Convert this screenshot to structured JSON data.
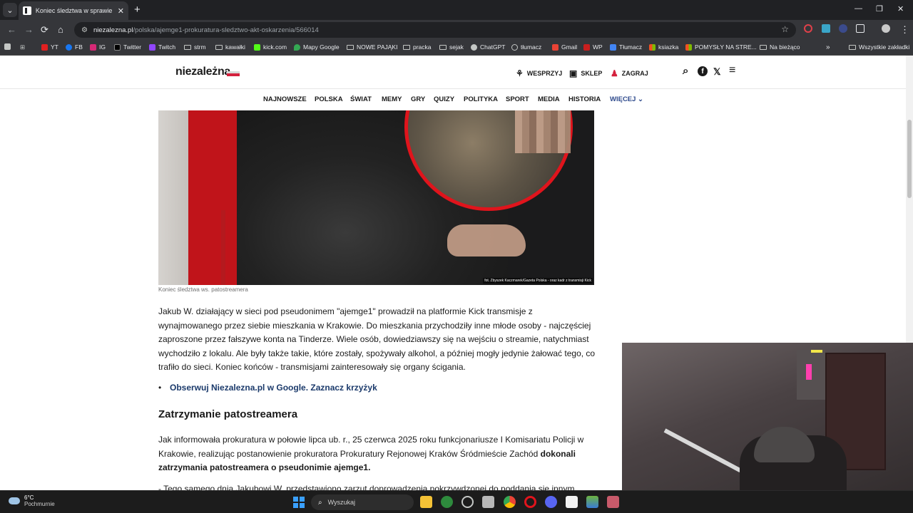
{
  "browser": {
    "tab_title": "Koniec śledztwa w sprawie pato",
    "url_host": "niezalezna.pl",
    "url_path": "/polska/ajemge1-prokuratura-sledztwo-akt-oskarzenia/566014",
    "bookmarks": [
      "YT",
      "FB",
      "IG",
      "Twitter",
      "Twitch",
      "strm",
      "kawałki",
      "kick.com",
      "Mapy Google",
      "NOWE PAJĄKI",
      "pracka",
      "sejak",
      "ChatGPT",
      "tłumacz",
      "Gmail",
      "WP",
      "Tłumacz",
      "ksiazka",
      "POMYSŁY NA STRE...",
      "Na bieżąco",
      "Wszystkie zakładki"
    ],
    "icons": {
      "back": "←",
      "forward": "→",
      "reload": "⟳",
      "home": "⌂",
      "star": "☆",
      "close": "✕",
      "newtab": "+",
      "minimize": "—",
      "restore": "❐",
      "tabmenu": "⌄",
      "more": "»"
    }
  },
  "site": {
    "logo": "niezależna",
    "header_links": {
      "support": "WESPRZYJ",
      "shop": "SKLEP",
      "play": "ZAGRAJ"
    },
    "header_icons": {
      "search": "⌕",
      "facebook": "f",
      "x": "𝕏",
      "menu": "≡"
    },
    "menu": [
      "NAJNOWSZE",
      "POLSKA",
      "ŚWIAT",
      "MEMY",
      "GRY",
      "QUIZY",
      "POLITYKA",
      "SPORT",
      "MEDIA",
      "HISTORIA"
    ],
    "menu_more": "WIĘCEJ ⌄"
  },
  "article": {
    "photo_credit": "fot. Zbyszek Kaczmarek/Gazeta Polska - oraz kadr z transmisji Kick",
    "caption": "Koniec śledztwa ws. patostreamera",
    "p1": [
      "Jakub W. działający w sieci pod pseudonimem \"ajemge1\" prowadził na platformie Kick transmisje z",
      "wynajmowanego przez siebie mieszkania w Krakowie. Do mieszkania przychodziły inne młode osoby - najczęściej",
      "zaproszone przez fałszywe konta na Tinderze. Wiele osób, dowiedziawszy się na wejściu o streamie, natychmiast",
      "wychodziło z lokalu. Ale były także takie, które zostały, spożywały alkohol, a później mogły jedynie żałować tego, co",
      "trafiło do sieci. Koniec końców - transmisjami zainteresowały się organy ścigania."
    ],
    "bullet": "Obserwuj Niezalezna.pl w Google. Zaznacz krzyżyk",
    "bullet_dot": "•",
    "heading": "Zatrzymanie patostreamera",
    "p2_lines": [
      "Jak informowała prokuratura w połowie lipca ub. r., 25 czerwca 2025 roku funkcjonariusze I Komisariatu Policji w",
      "Krakowie, realizując  postanowienie prokuratora Prokuratury Rejonowej Kraków Śródmieście Zachód"
    ],
    "p2_bold_inline": "dokonali",
    "p2_bold_line": "zatrzymania patostreamera o pseudonimie ajemge1.",
    "p3_partial": "- Tego samego dnia Jakubowi W. przedstawiono zarzut doprowadzenia pokrzywdzonej do poddania się innym"
  },
  "taskbar": {
    "temp": "6°C",
    "weather": "Pochmurnie",
    "search_placeholder": "Wyszukaj",
    "search_icon": "⌕"
  },
  "colors": {
    "accent_red": "#d4213d",
    "link_blue": "#1b3a6b",
    "menu_more": "#2e4a8c"
  }
}
